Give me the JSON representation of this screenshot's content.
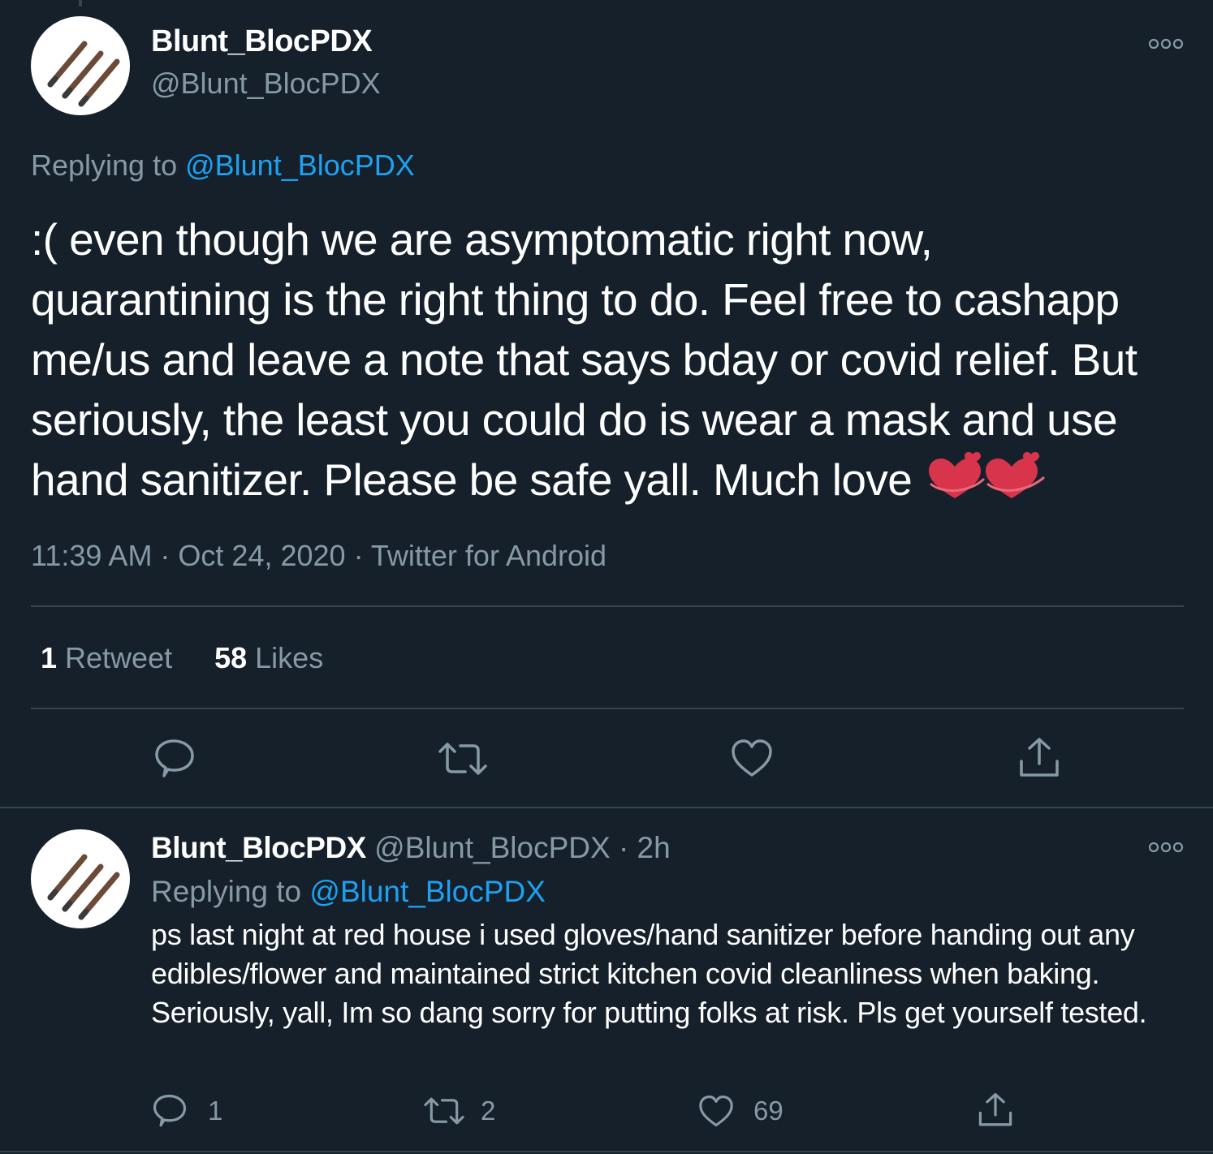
{
  "main_tweet": {
    "display_name": "Blunt_BlocPDX",
    "handle": "@Blunt_BlocPDX",
    "replying_prefix": "Replying to ",
    "replying_to": "@Blunt_BlocPDX",
    "text": ":( even though we are asymptomatic right now, quarantining is the right thing to do. Feel free to cashapp me/us and leave a note that says bday or covid relief. But seriously, the least you could do is wear a mask and use hand sanitizer. Please be safe yall. Much love",
    "emoji": "two-hearts",
    "meta": "11:39 AM · Oct 24, 2020 · Twitter for Android",
    "retweet_count": "1",
    "retweet_label": " Retweet",
    "like_count": "58",
    "like_label": " Likes"
  },
  "reply_tweet": {
    "display_name": "Blunt_BlocPDX",
    "handle_time": " @Blunt_BlocPDX · 2h",
    "replying_prefix": "Replying to ",
    "replying_to": "@Blunt_BlocPDX",
    "text": "ps last night at red house i used gloves/hand sanitizer before handing out any edibles/flower and maintained strict kitchen covid cleanliness when baking. Seriously, yall, Im so dang sorry for putting folks at risk. Pls get yourself tested.",
    "reply_count": "1",
    "retweet_count": "2",
    "like_count": "69"
  },
  "colors": {
    "background": "#15202b",
    "text": "#ffffff",
    "secondary": "#8899a6",
    "link": "#1da1f2",
    "divider": "#38444d"
  },
  "icons": [
    "reply-icon",
    "retweet-icon",
    "like-icon",
    "share-icon",
    "more-icon",
    "avatar-sticks"
  ]
}
